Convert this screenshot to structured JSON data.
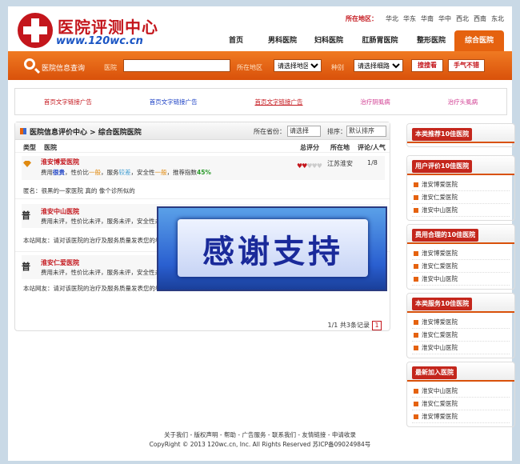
{
  "logo": {
    "title": "医院评测中心",
    "url": "www.120wc.cn"
  },
  "region": {
    "label": "所在地区：",
    "items": [
      "华北",
      "华东",
      "华南",
      "华中",
      "西北",
      "西南",
      "东北"
    ]
  },
  "nav": {
    "items": [
      "首页",
      "男科医院",
      "妇科医院",
      "肛肠胃医院",
      "整形医院",
      "综合医院"
    ],
    "active": "综合医院"
  },
  "searchbar": {
    "title": "医院信息查询",
    "hospital_label": "医院",
    "area_label": "所在地区",
    "area_select": "请选择地区",
    "type_label": "种别",
    "type_select": "请选择细路",
    "search_button": "搜搜看",
    "luck_button": "手气不错"
  },
  "ads": [
    "首页文字链接广告",
    "首页文字链接广告",
    "首页文字链接广告",
    "治疗阴虱病",
    "治疗头虱病"
  ],
  "main": {
    "breadcrumb": "医院信息评价中心 > 综合医院医院",
    "province_label": "所在省份：",
    "province_select": "请选择",
    "sort_label": "排序：",
    "sort_select": "默认排序",
    "columns": {
      "type": "类型",
      "hospital": "医院",
      "score": "总评分",
      "location": "所在地",
      "popularity": "评论/人气"
    },
    "entries": [
      {
        "name": "淮安博爱医院",
        "score_parts": [
          "费用",
          "很贵",
          "，性价比",
          "一般",
          "，服务",
          "较差",
          "，安全性",
          "一般",
          "，推荐指数",
          "45%"
        ],
        "location": "江苏淮安",
        "popularity": "1/8",
        "comment": "匿名：很黑的一家医院 真的 像个诊所似的"
      },
      {
        "type": "普",
        "name": "淮安中山医院",
        "score_line": "费用未评，性价比未评，服务未评，安全性未评，推荐指数",
        "comment": "本站网友：请对该医院的治疗及服务质量发表您的看法,方便其他网友选择优秀的医院"
      },
      {
        "type": "普",
        "name": "淮安仁爱医院",
        "score_line": "费用未评，性价比未评，服务未评，安全性未评，推荐指数",
        "comment": "本站网友：请对该医院的治疗及服务质量发表您的看法,方便其他网友选择优秀的医院"
      }
    ],
    "pager": {
      "info": "1/1 共3条记录",
      "page": "1"
    }
  },
  "overlay": {
    "text": "感谢支持"
  },
  "sidebar": [
    {
      "title": "本类推荐10佳医院",
      "items": []
    },
    {
      "title": "用户评价10佳医院",
      "items": [
        "淮安博爱医院",
        "淮安仁爱医院",
        "淮安中山医院"
      ]
    },
    {
      "title": "费用合理的10佳医院",
      "items": [
        "淮安博爱医院",
        "淮安仁爱医院",
        "淮安中山医院"
      ]
    },
    {
      "title": "本类服务10佳医院",
      "items": [
        "淮安博爱医院",
        "淮安仁爱医院",
        "淮安中山医院"
      ]
    },
    {
      "title": "最新加入医院",
      "items": [
        "淮安中山医院",
        "淮安仁爱医院",
        "淮安博爱医院"
      ]
    }
  ],
  "footer": {
    "links": "关于我们 - 版权声明 - 帮助 - 广告服务 - 联系我们 - 友情链接 - 申请收录",
    "copyright": "CopyRight © 2013 120wc.cn, Inc. All Rights Reserved 苏ICP备09024984号"
  }
}
